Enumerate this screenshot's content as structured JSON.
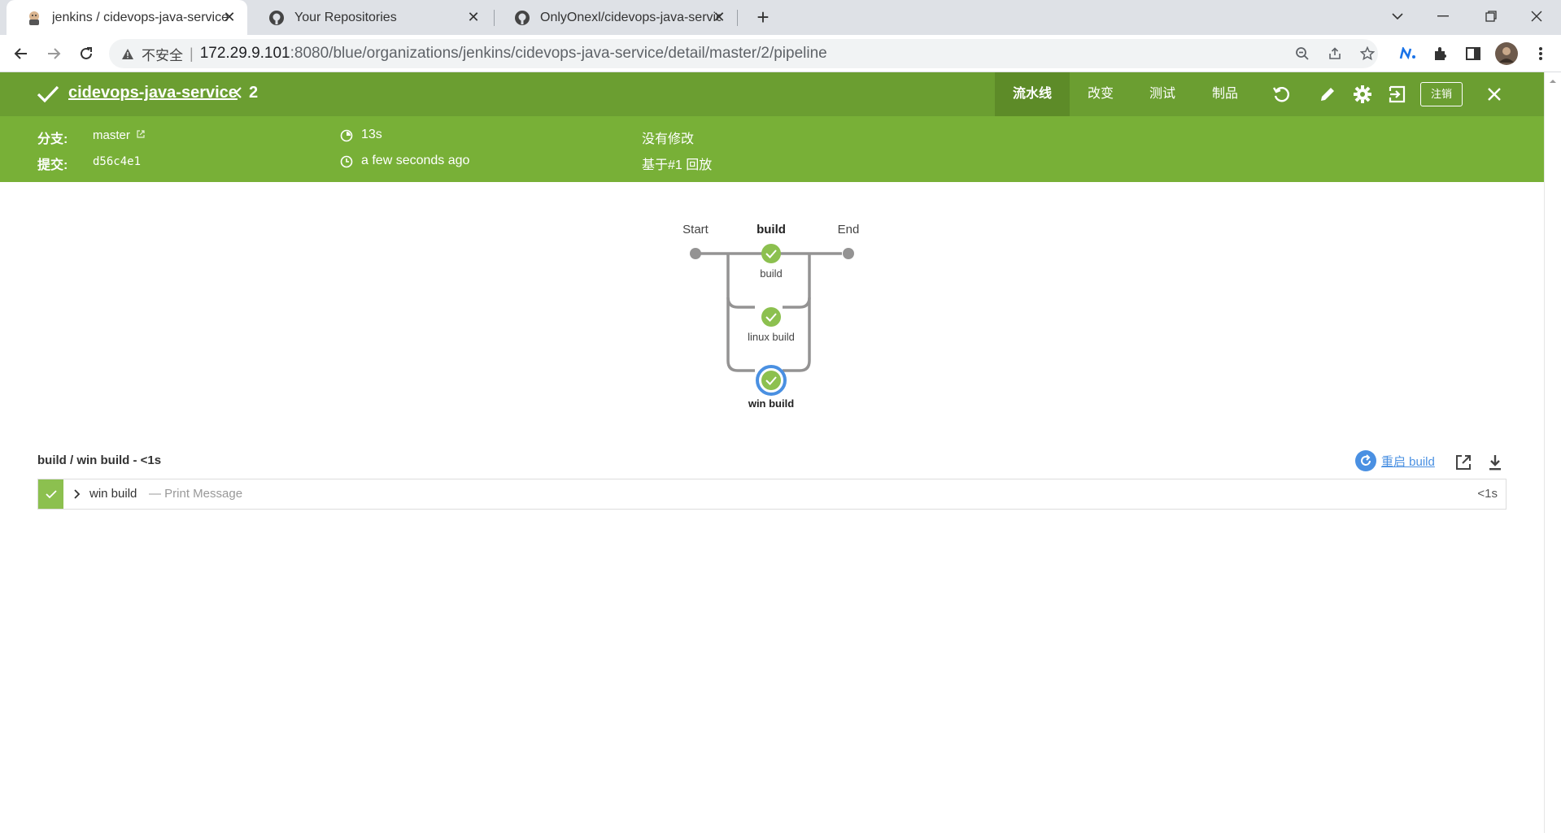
{
  "browser": {
    "tabs": [
      {
        "title": "jenkins / cidevops-java-service",
        "icon": "jenkins-icon",
        "active": true
      },
      {
        "title": "Your Repositories",
        "icon": "github-icon",
        "active": false
      },
      {
        "title": "OnlyOnexl/cidevops-java-service",
        "icon": "github-icon",
        "active": false
      }
    ],
    "security_label": "不安全",
    "url_host": "172.29.9.101",
    "url_rest": ":8080/blue/organizations/jenkins/cidevops-java-service/detail/master/2/pipeline"
  },
  "header": {
    "pipeline_name": "cidevops-java-service",
    "run_number": "2",
    "tabs": [
      "流水线",
      "改变",
      "测试",
      "制品"
    ],
    "logout": "注销",
    "branch_label": "分支:",
    "branch_value": "master",
    "commit_label": "提交:",
    "commit_value": "d56c4e1",
    "duration": "13s",
    "time_ago": "a few seconds ago",
    "changes": "没有修改",
    "replay_of": "基于#1 回放",
    "color_dark": "#6b9e31",
    "color_light": "#78b037"
  },
  "graph": {
    "start_label": "Start",
    "end_label": "End",
    "stage_label": "build",
    "branches": [
      "build",
      "linux build",
      "win build"
    ],
    "selected_branch": "win build",
    "success_color": "#8cc04f",
    "selected_ring_color": "#4a90e2"
  },
  "steps": {
    "title": "build / win build - <1s",
    "restart_label": "重启 build",
    "rows": [
      {
        "name": "win build",
        "description": "— Print Message",
        "duration": "<1s",
        "status": "success"
      }
    ]
  }
}
